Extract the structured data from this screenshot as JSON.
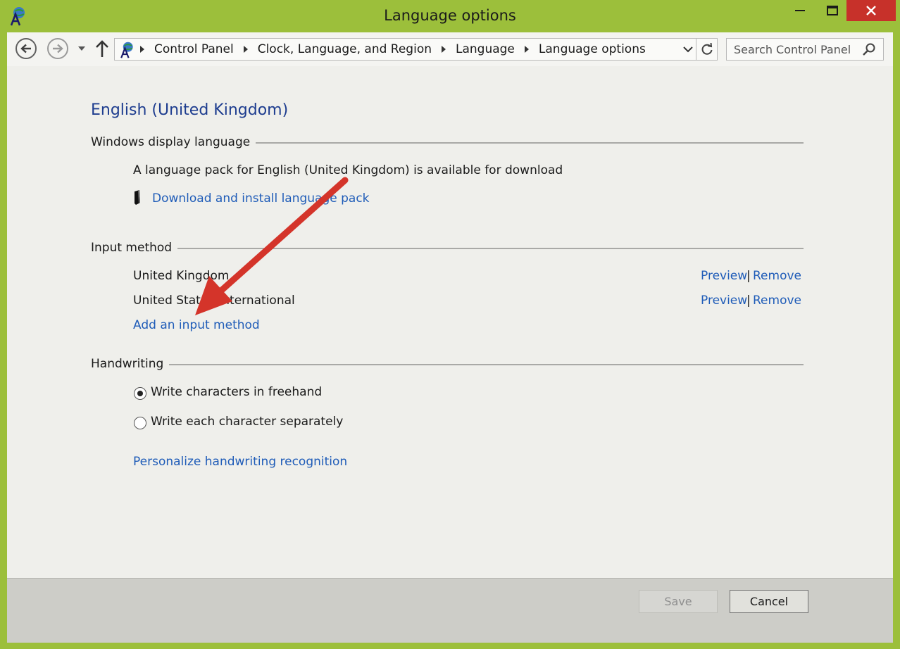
{
  "window": {
    "title": "Language options",
    "accent_color": "#9cbf3b",
    "close_color": "#c7312a"
  },
  "nav": {
    "breadcrumbs": [
      "Control Panel",
      "Clock, Language, and Region",
      "Language",
      "Language options"
    ],
    "search_placeholder": "Search Control Panel"
  },
  "page": {
    "heading": "English (United Kingdom)",
    "display_language": {
      "section_label": "Windows display language",
      "availability_text": "A language pack for English (United Kingdom) is available for download",
      "download_link": "Download and install language pack"
    },
    "input_method": {
      "section_label": "Input method",
      "methods": [
        {
          "name": "United Kingdom",
          "preview": "Preview",
          "separator": "|",
          "remove": "Remove"
        },
        {
          "name": "United States-International",
          "preview": "Preview",
          "separator": "|",
          "remove": "Remove"
        }
      ],
      "add_link": "Add an input method"
    },
    "handwriting": {
      "section_label": "Handwriting",
      "options": [
        {
          "label": "Write characters in freehand",
          "selected": true
        },
        {
          "label": "Write each character separately",
          "selected": false
        }
      ],
      "personalize_link": "Personalize handwriting recognition"
    }
  },
  "footer": {
    "save_label": "Save",
    "cancel_label": "Cancel"
  },
  "icons": [
    "language-icon",
    "minimize-icon",
    "maximize-icon",
    "close-icon",
    "back-arrow-icon",
    "forward-arrow-icon",
    "recent-pages-chevron-icon",
    "up-arrow-icon",
    "address-dropdown-icon",
    "refresh-icon",
    "search-icon",
    "uac-shield-icon"
  ],
  "annotation_color": "#d4342a"
}
